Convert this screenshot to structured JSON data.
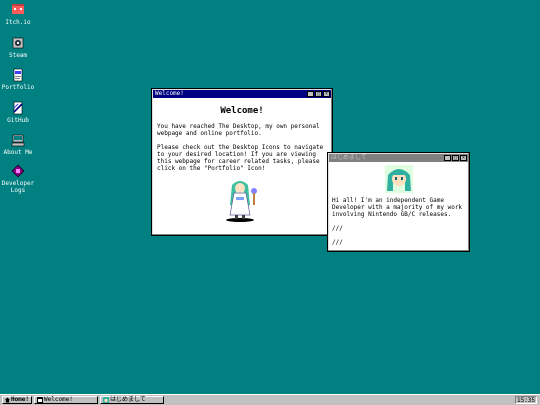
{
  "desktop": {
    "icons": [
      {
        "label": "Itch.io",
        "icon": "itchio-icon"
      },
      {
        "label": "Steam",
        "icon": "steam-icon"
      },
      {
        "label": "Portfolio",
        "icon": "portfolio-icon"
      },
      {
        "label": "GitHub",
        "icon": "github-icon"
      },
      {
        "label": "About Me",
        "icon": "about-me-icon"
      },
      {
        "label": "Developer Logs",
        "label_line1": "Developer",
        "label_line2": "Logs",
        "icon": "developer-logs-icon"
      }
    ]
  },
  "welcome_window": {
    "title": "Welcome!",
    "heading": "Welcome!",
    "para1": "You have reached The Desktop, my own personal webpage and online portfolio.",
    "para2": "Please check out the Desktop Icons to navigate to your desired location! If you are viewing this webpage for career related tasks, please click on the \"Portfolio\" Icon!"
  },
  "intro_window": {
    "title": "はじめまして",
    "text": "Hi all! I'm an independent Game Developer with a majority of my work involving Nintendo GB/C releases.",
    "line2": "///",
    "line3": "///"
  },
  "title_buttons": {
    "minimize": "_",
    "maximize": "□",
    "close": "×"
  },
  "taskbar": {
    "start_label": "Home!",
    "items": [
      "Welcome!",
      "はじめまして"
    ],
    "clock": "15:35"
  },
  "colors": {
    "desktop": "#008080",
    "title_active": "#000080",
    "title_inactive": "#808080"
  }
}
